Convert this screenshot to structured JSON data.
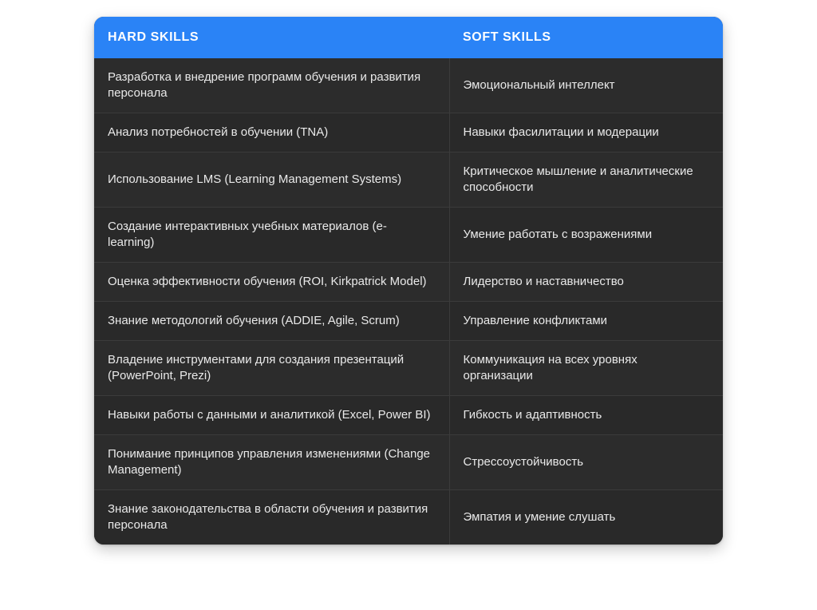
{
  "page": {
    "background_color": "#ffffff"
  },
  "table": {
    "accent_color": "#2a83f6",
    "row_color": "#2c2c2c",
    "row_alt_color": "#292929",
    "divider_color": "#3b3b3b",
    "text_color": "#e9e9e9",
    "header_text_color": "#ffffff",
    "columns": [
      {
        "key": "hard",
        "label": "HARD SKILLS"
      },
      {
        "key": "soft",
        "label": "SOFT SKILLS"
      }
    ],
    "rows": [
      {
        "hard": "Разработка и внедрение программ обучения и развития персонала",
        "soft": "Эмоциональный интеллект"
      },
      {
        "hard": "Анализ потребностей в обучении (TNA)",
        "soft": "Навыки фасилитации и модерации"
      },
      {
        "hard": "Использование LMS (Learning Management Systems)",
        "soft": "Критическое мышление и аналитические способности"
      },
      {
        "hard": "Создание интерактивных учебных материалов (e-learning)",
        "soft": "Умение работать с возражениями"
      },
      {
        "hard": "Оценка эффективности обучения (ROI, Kirkpatrick Model)",
        "soft": "Лидерство и наставничество"
      },
      {
        "hard": "Знание методологий обучения (ADDIE, Agile, Scrum)",
        "soft": "Управление конфликтами"
      },
      {
        "hard": "Владение инструментами для создания презентаций (PowerPoint, Prezi)",
        "soft": "Коммуникация на всех уровнях организации"
      },
      {
        "hard": "Навыки работы с данными и аналитикой (Excel, Power BI)",
        "soft": "Гибкость и адаптивность"
      },
      {
        "hard": "Понимание принципов управления изменениями (Change Management)",
        "soft": "Стрессоустойчивость"
      },
      {
        "hard": "Знание законодательства в области обучения и развития персонала",
        "soft": "Эмпатия и умение слушать"
      }
    ]
  }
}
